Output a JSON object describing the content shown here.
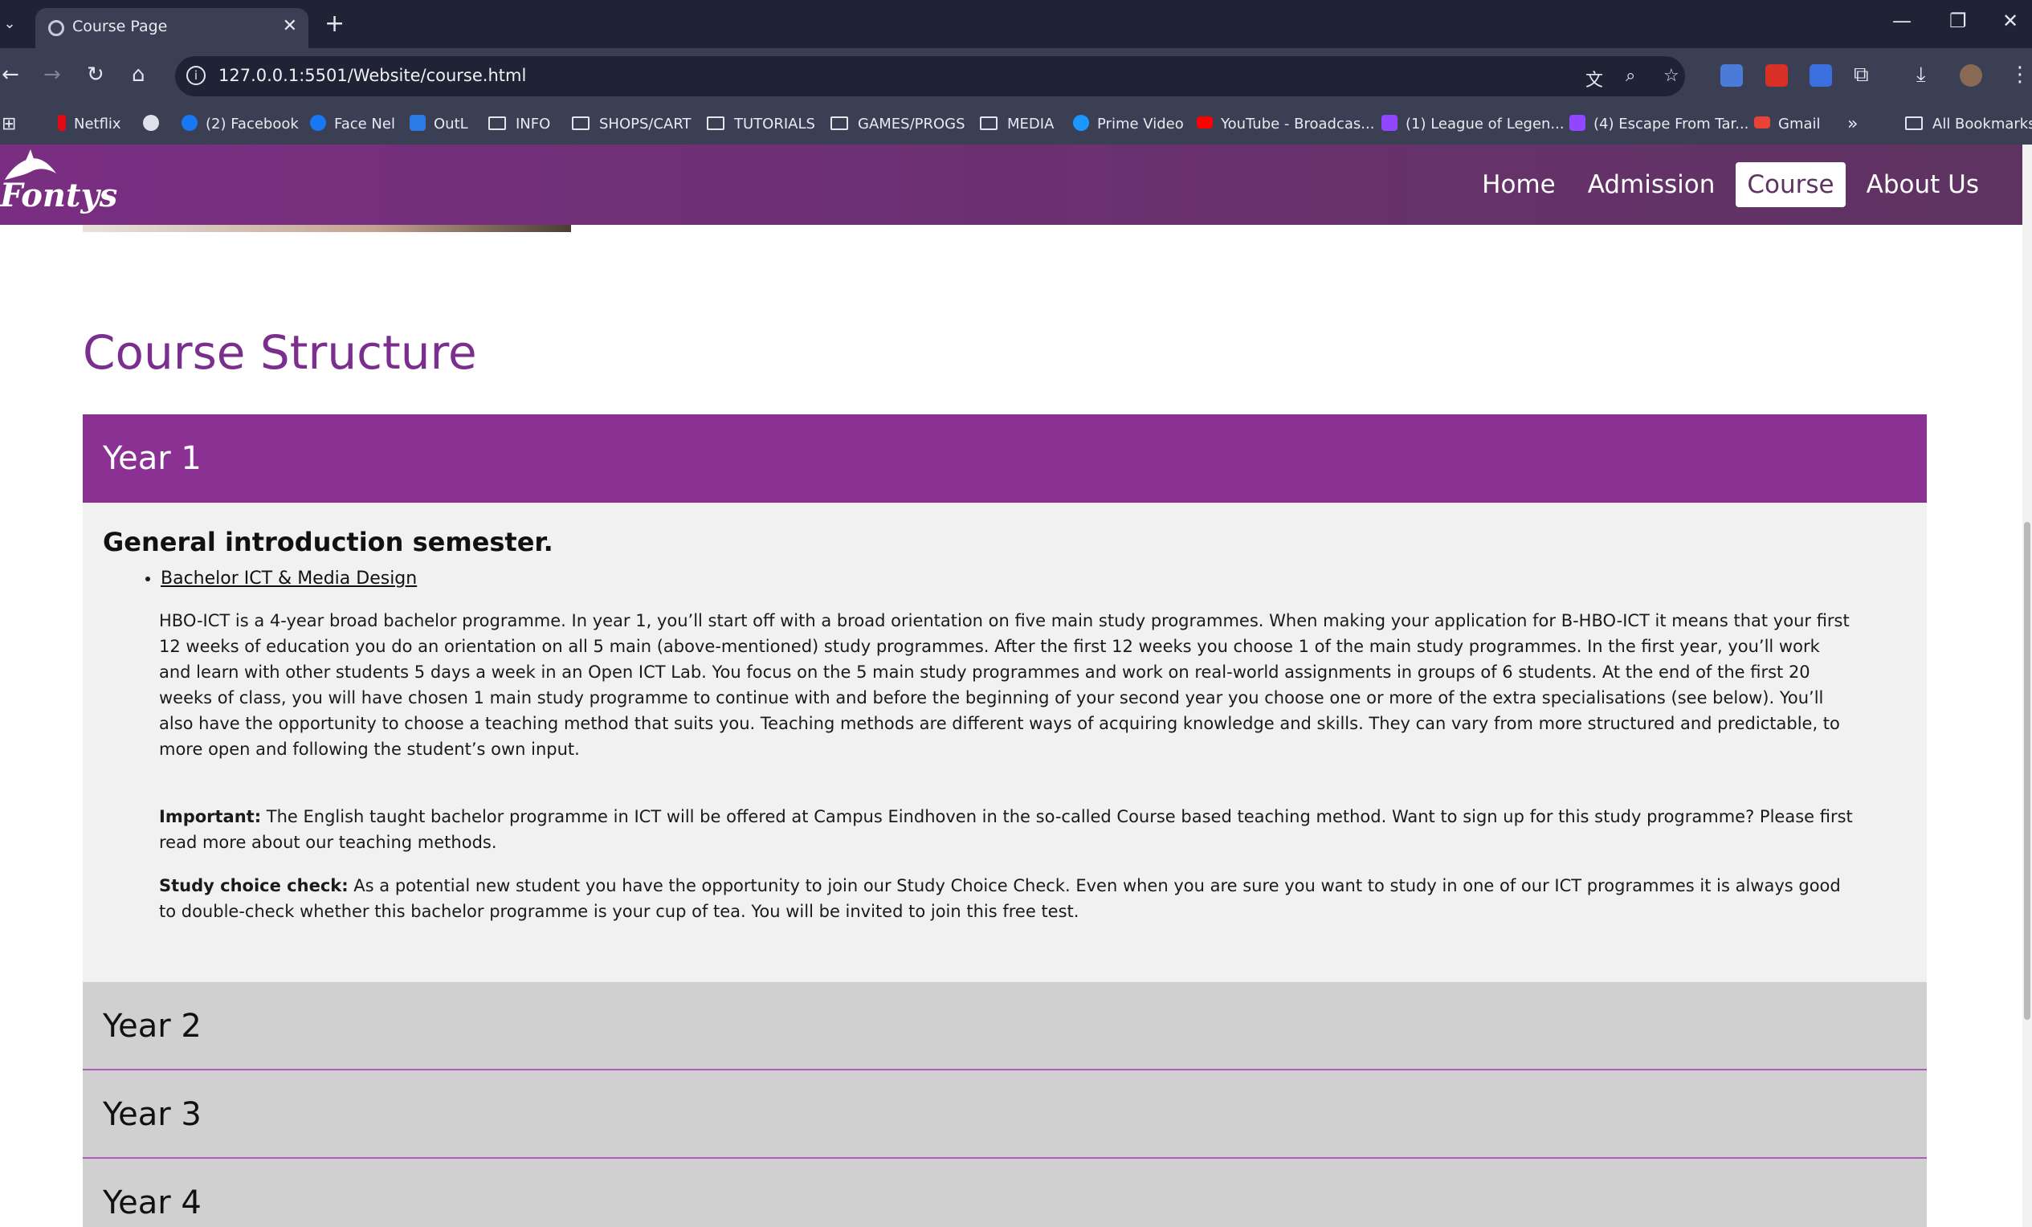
{
  "browser": {
    "tab_title": "Course Page",
    "url": "127.0.0.1:5501/Website/course.html",
    "bookmarks": [
      {
        "label": "Netflix",
        "kind": "site",
        "color": "#e50914"
      },
      {
        "label": "",
        "kind": "globe",
        "color": "#dfe2ea"
      },
      {
        "label": "(2) Facebook",
        "kind": "site",
        "color": "#1877f2"
      },
      {
        "label": "Face Nel",
        "kind": "site",
        "color": "#1877f2"
      },
      {
        "label": "OutL",
        "kind": "site",
        "color": "#2a7be4"
      },
      {
        "label": "INFO",
        "kind": "folder"
      },
      {
        "label": "SHOPS/CART",
        "kind": "folder"
      },
      {
        "label": "TUTORIALS",
        "kind": "folder"
      },
      {
        "label": "GAMES/PROGS",
        "kind": "folder"
      },
      {
        "label": "MEDIA",
        "kind": "folder"
      },
      {
        "label": "Prime Video",
        "kind": "site",
        "color": "#1a98ff"
      },
      {
        "label": "YouTube - Broadcas...",
        "kind": "site",
        "color": "#ff0000"
      },
      {
        "label": "(1) League of Legen...",
        "kind": "site",
        "color": "#9146ff"
      },
      {
        "label": "(4) Escape From Tar...",
        "kind": "site",
        "color": "#9146ff"
      },
      {
        "label": "Gmail",
        "kind": "site",
        "color": "#ea4335"
      }
    ],
    "all_bookmarks": "All Bookmarks"
  },
  "site": {
    "logo_text": "Fontys",
    "nav": [
      "Home",
      "Admission",
      "Course",
      "About Us"
    ],
    "active_nav": "Course"
  },
  "main": {
    "section_title": "Course Structure",
    "years": [
      "Year 1",
      "Year 2",
      "Year 3",
      "Year 4"
    ],
    "year1": {
      "subheading": "General introduction semester.",
      "link": "Bachelor ICT & Media Design",
      "paragraph": "HBO-ICT is a 4-year broad bachelor programme. In year 1, you’ll start off with a broad orientation on five main study programmes. When making your application for B-HBO-ICT it means that your first 12 weeks of education you do an orientation on all 5 main (above-mentioned) study programmes. After the first 12 weeks you choose 1 of the main study programmes. In the first year, you’ll work and learn with other students 5 days a week in an Open ICT Lab. You focus on the 5 main study programmes and work on real-world assignments in groups of 6 students. At the end of the first 20 weeks of class, you will have chosen 1 main study programme to continue with and before the beginning of your second year you choose one or more of the extra specialisations (see below). You’ll also have the opportunity to choose a teaching method that suits you. Teaching methods are different ways of acquiring knowledge and skills. They can vary from more structured and predictable, to more open and following the student’s own input.",
      "important_label": "Important:",
      "important_text": " The English taught bachelor programme in ICT will be offered at Campus Eindhoven in the so-called Course based teaching method. Want to sign up for this study programme? Please first read more about our teaching methods.",
      "check_label": "Study choice check:",
      "check_text": " As a potential new student you have the opportunity to join our Study Choice Check. Even when you are sure you want to study in one of our ICT programmes it is always good to double-check whether this bachelor programme is your cup of tea. You will be invited to join this free test."
    }
  },
  "colors": {
    "nav_start": "#7a2e82",
    "nav_end": "#5e3361",
    "title_purple": "#7b2e8e",
    "open_header": "#8a3193"
  }
}
